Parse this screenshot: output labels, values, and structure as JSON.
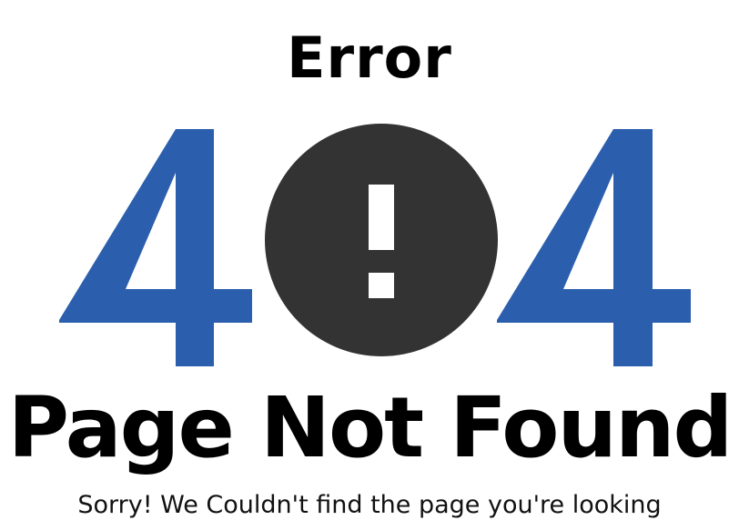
{
  "error_page": {
    "title": "Error",
    "code_left_digit": "4",
    "code_right_digit": "4",
    "headline": "Page Not Found",
    "message": "Sorry! We Couldn't find the page you're looking"
  },
  "icons": {
    "center_symbol": "exclamation-circle-icon"
  },
  "colors": {
    "digit_blue": "#2b5fad",
    "circle_dark": "#333333",
    "background": "#ffffff",
    "text": "#000000"
  }
}
